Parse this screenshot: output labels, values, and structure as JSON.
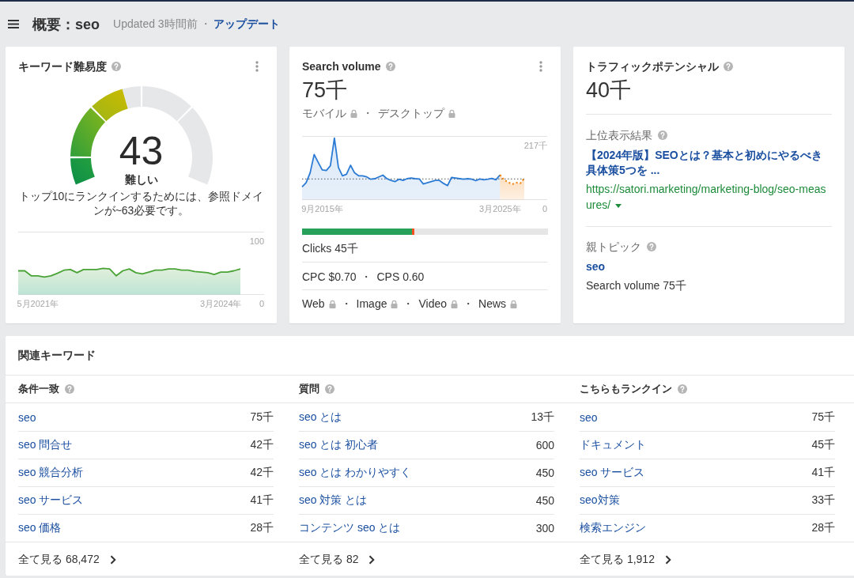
{
  "header": {
    "title": "概要：seo",
    "updated": "Updated 3時間前",
    "separator": "・",
    "update_link": "アップデート"
  },
  "keyword_difficulty": {
    "title": "キーワード難易度",
    "value": "43",
    "level": 0.43,
    "rating": "難しい",
    "description": "トップ10にランクインするためには、参照ドメインが~63必要です。",
    "chart_data": {
      "type": "area",
      "categories": [
        null,
        null,
        null,
        "5月2021年",
        null,
        null,
        null,
        null,
        null,
        null,
        null,
        null,
        null,
        null,
        null,
        null,
        null,
        null,
        null,
        null,
        null,
        null,
        null,
        null,
        null,
        null,
        null,
        null,
        null,
        null,
        null,
        "3月2024年",
        null,
        null,
        null
      ],
      "series": [
        {
          "color": "#4aa336",
          "values": [
            38,
            38,
            30,
            30,
            28,
            30,
            34,
            39,
            40,
            35,
            40,
            40,
            40,
            42,
            41,
            30,
            38,
            41,
            35,
            33,
            36,
            39,
            39,
            41,
            41,
            39,
            39,
            37,
            36,
            35,
            32,
            36,
            36,
            38,
            41
          ]
        }
      ],
      "yticks": [
        {
          "value": 0,
          "label": "0"
        },
        {
          "value": 100,
          "label": "100"
        }
      ],
      "ylim": [
        0,
        100
      ]
    }
  },
  "search_volume": {
    "title": "Search volume",
    "value": "75千",
    "devices": [
      {
        "label": "モバイル",
        "locked": true
      },
      {
        "prefix": "・",
        "label": "デスクトップ",
        "locked": true
      }
    ],
    "chart_data": {
      "type": "area",
      "categories": [
        null,
        null,
        null,
        null,
        null,
        "9月2015年",
        null,
        null,
        null,
        null,
        null,
        null,
        null,
        null,
        null,
        null,
        null,
        null,
        null,
        null,
        null,
        null,
        null,
        null,
        null,
        null,
        null,
        null,
        null,
        null,
        null,
        null,
        null,
        null,
        null,
        null,
        null,
        null,
        null,
        null,
        null,
        null,
        null,
        null,
        null,
        null,
        null,
        null,
        null,
        "3月2025年",
        null,
        null,
        null,
        null,
        null,
        null
      ],
      "series": [
        {
          "color": "#2b7bd5",
          "values": [
            44,
            58,
            92,
            155,
            128,
            102,
            100,
            116,
            211,
            110,
            82,
            87,
            118,
            92,
            82,
            82,
            78,
            70,
            72,
            78,
            84,
            72,
            66,
            62,
            70,
            66,
            72,
            74,
            72,
            71,
            54,
            58,
            62,
            66,
            66,
            56,
            48,
            76,
            74,
            72,
            70,
            72,
            70,
            65,
            71,
            68,
            70,
            73,
            68,
            85,
            null,
            null,
            null,
            null,
            null,
            null
          ]
        },
        {
          "color": "#f57c00",
          "values": [
            null,
            null,
            null,
            null,
            null,
            null,
            null,
            null,
            null,
            null,
            null,
            null,
            null,
            null,
            null,
            null,
            null,
            null,
            null,
            null,
            null,
            null,
            null,
            null,
            null,
            null,
            null,
            null,
            null,
            null,
            null,
            null,
            null,
            null,
            null,
            null,
            null,
            null,
            null,
            null,
            null,
            null,
            null,
            null,
            null,
            null,
            null,
            null,
            null,
            85,
            68,
            60,
            53,
            58,
            56,
            73
          ]
        }
      ],
      "yticks": [
        {
          "value": 0,
          "label": "0"
        },
        {
          "value": 217,
          "label": "217千"
        }
      ],
      "ylim": [
        0,
        217
      ],
      "ref_lines": [
        {
          "axis": "y",
          "value": 71
        }
      ]
    },
    "clicks_bar": [
      {
        "level": 0.447,
        "color": "#27a059"
      },
      {
        "level": 0.008,
        "color": "#f4511e"
      }
    ],
    "clicks": "Clicks 45千",
    "costs": [
      {
        "label": "CPC $0.70"
      },
      {
        "prefix": "・",
        "label": "CPS 0.60"
      }
    ],
    "sources": [
      {
        "label": "Web",
        "locked": true
      },
      {
        "prefix": "・",
        "label": "Image",
        "locked": true
      },
      {
        "prefix": "・",
        "label": "Video",
        "locked": true
      },
      {
        "prefix": "・",
        "label": "News",
        "locked": true
      }
    ]
  },
  "traffic_potential": {
    "title": "トラフィックポテンシャル",
    "value": "40千",
    "top_result": {
      "label": "上位表示結果",
      "title": "【2024年版】SEOとは？基本と初めにやるべき具体策5つを ...",
      "url": "https://satori.marketing/marketing-blog/seo-measures/"
    },
    "parent_topic": {
      "label": "親トピック",
      "keyword": "seo",
      "volume": "Search volume 75千"
    }
  },
  "related_keywords": {
    "title": "関連キーワード",
    "columns": [
      {
        "title": "条件一致",
        "rows": [
          {
            "keyword": "seo",
            "volume": "75千"
          },
          {
            "keyword": "seo 問合せ",
            "volume": "42千"
          },
          {
            "keyword": "seo 競合分析",
            "volume": "42千"
          },
          {
            "keyword": "seo サービス",
            "volume": "41千"
          },
          {
            "keyword": "seo 価格",
            "volume": "28千"
          }
        ],
        "footer": "全て見る 68,472"
      },
      {
        "title": "質問",
        "rows": [
          {
            "keyword": "seo とは",
            "volume": "13千"
          },
          {
            "keyword": "seo とは 初心者",
            "volume": "600"
          },
          {
            "keyword": "seo とは わかりやすく",
            "volume": "450"
          },
          {
            "keyword": "seo 対策 とは",
            "volume": "450"
          },
          {
            "keyword": "コンテンツ seo とは",
            "volume": "300"
          }
        ],
        "footer": "全て見る 82"
      },
      {
        "title": "こちらもランクイン",
        "rows": [
          {
            "keyword": "seo",
            "volume": "75千"
          },
          {
            "keyword": "ドキュメント",
            "volume": "45千"
          },
          {
            "keyword": "seo サービス",
            "volume": "41千"
          },
          {
            "keyword": "seo対策",
            "volume": "33千"
          },
          {
            "keyword": "検索エンジン",
            "volume": "28千"
          }
        ],
        "footer": "全て見る 1,912"
      }
    ]
  }
}
